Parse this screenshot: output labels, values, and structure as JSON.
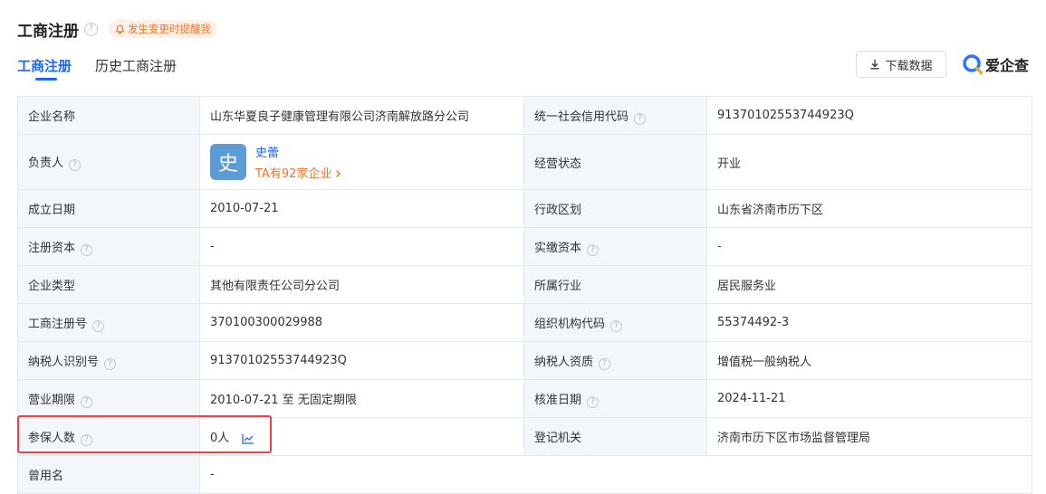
{
  "header": {
    "title": "工商注册",
    "reminder": "发生变更时提醒我",
    "download_label": "下载数据",
    "logo_text": "爱企查"
  },
  "tabs": [
    {
      "label": "工商注册",
      "active": true
    },
    {
      "label": "历史工商注册",
      "active": false
    }
  ],
  "info": {
    "company_name_label": "企业名称",
    "company_name": "山东华夏良子健康管理有限公司济南解放路分公司",
    "credit_code_label": "统一社会信用代码",
    "credit_code": "91370102553744923Q",
    "owner_label": "负责人",
    "owner_avatar": "史",
    "owner_name": "史蕾",
    "owner_companies": "TA有92家企业",
    "status_label": "经营状态",
    "status": "开业",
    "founded_label": "成立日期",
    "founded": "2010-07-21",
    "region_label": "行政区划",
    "region": "山东省济南市历下区",
    "reg_capital_label": "注册资本",
    "reg_capital": "-",
    "paid_capital_label": "实缴资本",
    "paid_capital": "-",
    "type_label": "企业类型",
    "type": "其他有限责任公司分公司",
    "industry_label": "所属行业",
    "industry": "居民服务业",
    "reg_no_label": "工商注册号",
    "reg_no": "370100300029988",
    "org_code_label": "组织机构代码",
    "org_code": "55374492-3",
    "taxpayer_id_label": "纳税人识别号",
    "taxpayer_id": "91370102553744923Q",
    "taxpayer_qual_label": "纳税人资质",
    "taxpayer_qual": "增值税一般纳税人",
    "term_label": "营业期限",
    "term": "2010-07-21 至 无固定期限",
    "approved_label": "核准日期",
    "approved": "2024-11-21",
    "insured_label": "参保人数",
    "insured": "0人",
    "authority_label": "登记机关",
    "authority": "济南市历下区市场监督管理局",
    "former_name_label": "曾用名",
    "former_name": "-"
  },
  "colors": {
    "accent": "#1a66ff",
    "warning": "#f07328",
    "highlight": "#e8454b"
  }
}
